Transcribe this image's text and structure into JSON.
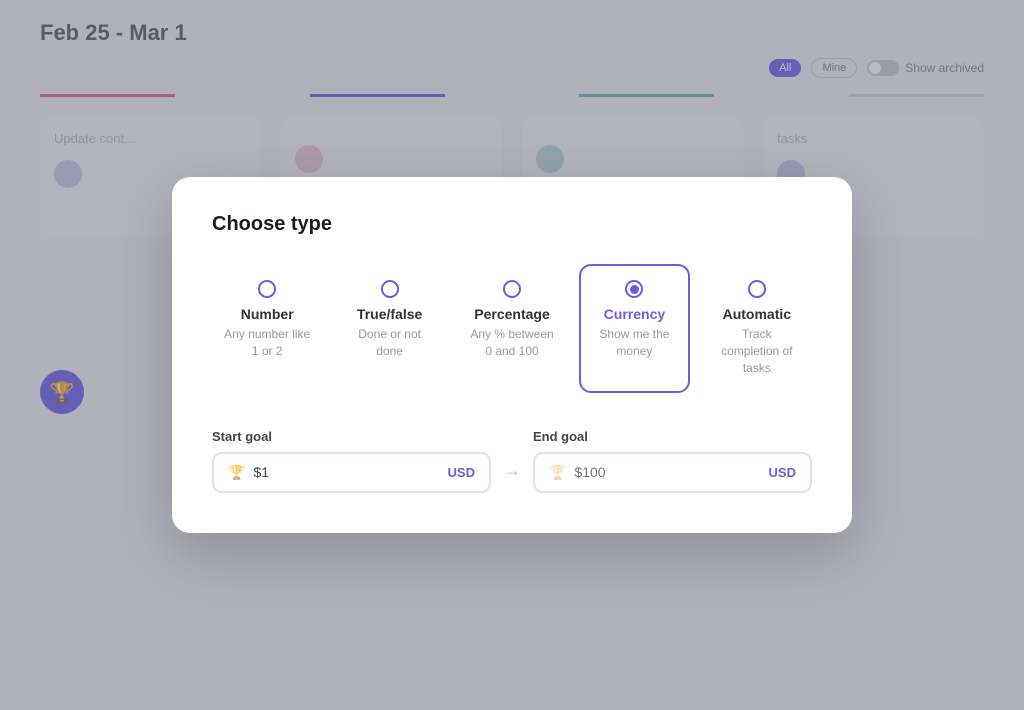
{
  "background": {
    "date_range": "Feb 25 - Mar 1",
    "filter_all": "All",
    "filter_mine": "Mine",
    "show_archived": "Show archived",
    "columns": [
      {
        "title": "Update cont...",
        "avatar_color": "purple"
      },
      {
        "title": "",
        "avatar_color": "pink"
      },
      {
        "title": "",
        "avatar_color": "teal"
      },
      {
        "title": "tasks",
        "avatar_color": "purple"
      }
    ]
  },
  "modal": {
    "title": "Choose type",
    "types": [
      {
        "id": "number",
        "label": "Number",
        "description": "Any number like 1 or 2",
        "selected": false
      },
      {
        "id": "true_false",
        "label": "True/false",
        "description": "Done or not done",
        "selected": false
      },
      {
        "id": "percentage",
        "label": "Percentage",
        "description": "Any % between 0 and 100",
        "selected": false
      },
      {
        "id": "currency",
        "label": "Currency",
        "description": "Show me the money",
        "selected": true
      },
      {
        "id": "automatic",
        "label": "Automatic",
        "description": "Track completion of tasks",
        "selected": false
      }
    ],
    "start_goal": {
      "label": "Start goal",
      "value": "$1",
      "currency": "USD"
    },
    "end_goal": {
      "label": "End goal",
      "placeholder": "$100",
      "currency": "USD"
    }
  }
}
